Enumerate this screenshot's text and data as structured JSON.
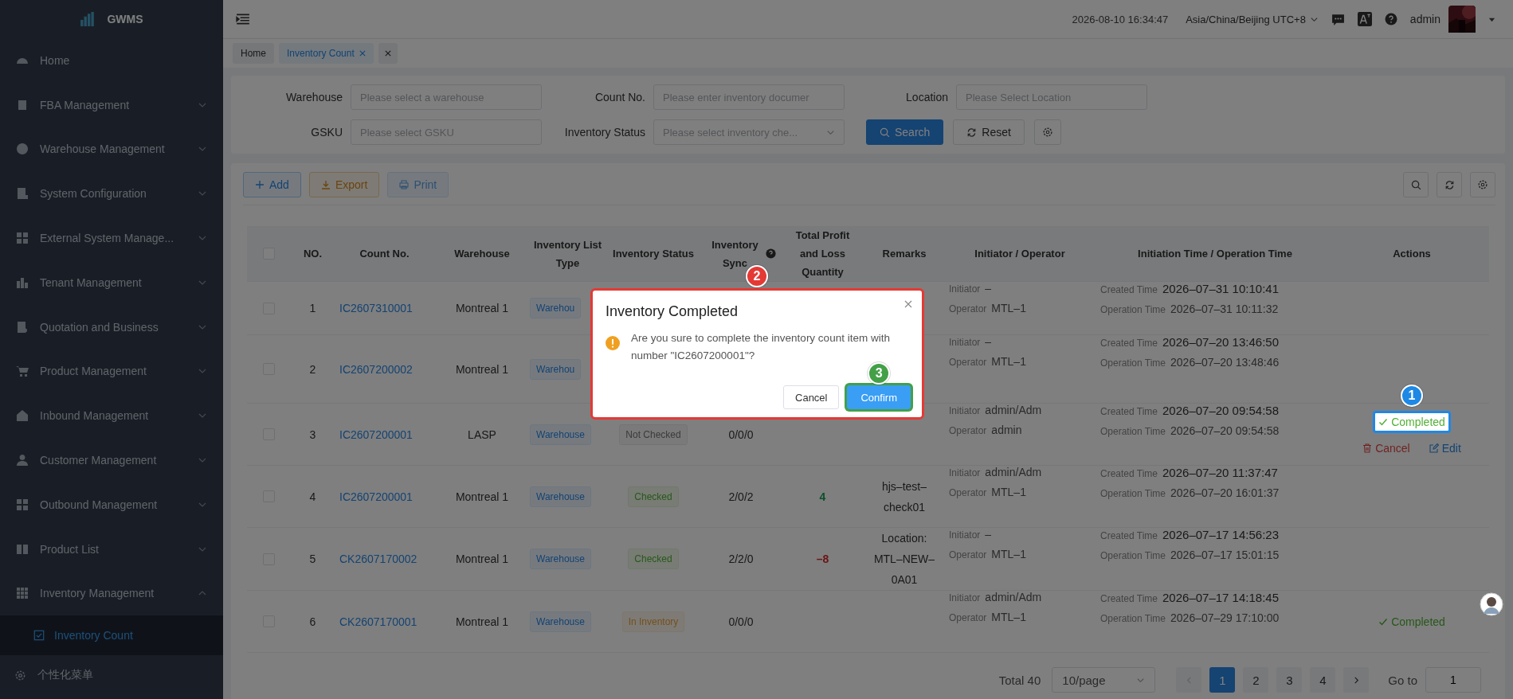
{
  "brand": "GWMS",
  "sidebar": {
    "items": [
      {
        "label": "Home"
      },
      {
        "label": "FBA Management",
        "expanded": false
      },
      {
        "label": "Warehouse Management",
        "expanded": false
      },
      {
        "label": "System Configuration",
        "expanded": false
      },
      {
        "label": "External System Manage...",
        "expanded": false
      },
      {
        "label": "Tenant Management",
        "expanded": false
      },
      {
        "label": "Quotation and Business",
        "expanded": false
      },
      {
        "label": "Product Management",
        "expanded": false
      },
      {
        "label": "Inbound Management",
        "expanded": false
      },
      {
        "label": "Customer Management",
        "expanded": false
      },
      {
        "label": "Outbound Management",
        "expanded": false
      },
      {
        "label": "Product List",
        "expanded": false
      },
      {
        "label": "Inventory Management",
        "expanded": true,
        "children": [
          {
            "label": "Inventory Count",
            "selected": true
          }
        ]
      }
    ],
    "footer": "个性化菜单"
  },
  "header": {
    "datetime": "2026-08-10 16:34:47",
    "timezone": "Asia/China/Beijing UTC+8",
    "user": "admin"
  },
  "tabs": [
    {
      "label": "Home",
      "selected": false,
      "closable": false
    },
    {
      "label": "Inventory Count",
      "selected": true,
      "closable": true
    }
  ],
  "close_all_tabs": true,
  "filters": [
    {
      "label": "Warehouse",
      "placeholder": "Please select a warehouse",
      "kind": "input"
    },
    {
      "label": "Count No.",
      "placeholder": "Please enter inventory documer",
      "kind": "input"
    },
    {
      "label": "Location",
      "placeholder": "Please Select Location",
      "kind": "input"
    },
    {
      "label": "GSKU",
      "placeholder": "Please select GSKU",
      "kind": "input"
    },
    {
      "label": "Inventory Status",
      "placeholder": "Please select inventory che...",
      "kind": "select"
    }
  ],
  "filter_buttons": [
    {
      "label": "Search",
      "kind": "search"
    },
    {
      "label": "Reset",
      "kind": "reset"
    }
  ],
  "toolbar": [
    {
      "label": "Add",
      "kind": "add",
      "disabled": false
    },
    {
      "label": "Export",
      "kind": "export",
      "disabled": false
    },
    {
      "label": "Print",
      "kind": "print",
      "disabled": true
    }
  ],
  "table": {
    "all_checked": false,
    "columns": [
      "NO.",
      "Count No.",
      "Warehouse",
      "Inventory List Type",
      "Inventory Status",
      "Inventory Sync",
      "Total Profit and Loss Quantity",
      "Remarks",
      "Initiator / Operator",
      "Initiation Time / Operation Time",
      "Actions"
    ],
    "rows": [
      {
        "checked": false,
        "no": "1",
        "count_no": "IC2607310001",
        "warehouse": "Montreal 1",
        "list_type": "Warehou",
        "initiator_label": "Initiator",
        "initiator": "–",
        "operator_label": "Operator",
        "operator": "MTL–1",
        "created_label": "Created Time",
        "created": "2026–07–31 10:10:41",
        "operation_label": "Operation Time",
        "operation": "2026–07–31 10:11:32",
        "actions": []
      },
      {
        "checked": false,
        "no": "2",
        "count_no": "IC2607200002",
        "warehouse": "Montreal 1",
        "list_type": "Warehou",
        "initiator_label": "Initiator",
        "initiator": "–",
        "operator_label": "Operator",
        "operator": "MTL–1",
        "created_label": "Created Time",
        "created": "2026–07–20 13:46:50",
        "operation_label": "Operation Time",
        "operation": "2026–07–20 13:48:46",
        "actions": []
      },
      {
        "checked": false,
        "no": "3",
        "count_no": "IC2607200001",
        "warehouse": "LASP",
        "list_type": "Warehouse",
        "status": {
          "label": "Not Checked",
          "kind": "not_checked"
        },
        "sync": "0/0/0",
        "initiator_label": "Initiator",
        "initiator": "admin/Adm",
        "operator_label": "Operator",
        "operator": "admin",
        "created_label": "Created Time",
        "created": "2026–07–20 09:54:58",
        "operation_label": "Operation Time",
        "operation": "2026–07–20 09:54:58",
        "actions": [
          {
            "label": "Completed",
            "kind": "complete",
            "callout": {
              "number": "1",
              "color": "#1e88e5"
            }
          },
          {
            "label": "Cancel",
            "kind": "cancel"
          },
          {
            "label": "Edit",
            "kind": "edit"
          }
        ]
      },
      {
        "checked": false,
        "no": "4",
        "count_no": "IC2607200001",
        "warehouse": "Montreal 1",
        "list_type": "Warehouse",
        "status": {
          "label": "Checked",
          "kind": "checked"
        },
        "sync": "2/0/2",
        "total": {
          "value": "4",
          "kind": "gain"
        },
        "remarks": "hjs–test–check01",
        "initiator_label": "Initiator",
        "initiator": "admin/Adm",
        "operator_label": "Operator",
        "operator": "MTL–1",
        "created_label": "Created Time",
        "created": "2026–07–20 11:37:47",
        "operation_label": "Operation Time",
        "operation": "2026–07–20 16:01:37",
        "actions": []
      },
      {
        "checked": false,
        "no": "5",
        "count_no": "CK2607170002",
        "warehouse": "Montreal 1",
        "list_type": "Warehouse",
        "status": {
          "label": "Checked",
          "kind": "checked"
        },
        "sync": "2/2/0",
        "total": {
          "value": "–8",
          "kind": "loss"
        },
        "remarks": "Location: MTL–NEW–0A01",
        "initiator_label": "Initiator",
        "initiator": "–",
        "operator_label": "Operator",
        "operator": "MTL–1",
        "created_label": "Created Time",
        "created": "2026–07–17 14:56:23",
        "operation_label": "Operation Time",
        "operation": "2026–07–17 15:01:15",
        "actions": []
      },
      {
        "checked": false,
        "no": "6",
        "count_no": "CK2607170001",
        "warehouse": "Montreal 1",
        "list_type": "Warehouse",
        "status": {
          "label": "In Inventory",
          "kind": "in_inventory"
        },
        "sync": "0/0/0",
        "initiator_label": "Initiator",
        "initiator": "admin/Adm",
        "operator_label": "Operator",
        "operator": "MTL–1",
        "created_label": "Created Time",
        "created": "2026–07–17 14:18:45",
        "operation_label": "Operation Time",
        "operation": "2026–07–29 17:10:00",
        "actions": [
          {
            "label": "Completed",
            "kind": "complete"
          }
        ]
      }
    ]
  },
  "pagination": {
    "total": "Total 40",
    "page_size": "10/page",
    "pages": [
      {
        "label": "1",
        "selected": true
      },
      {
        "label": "2",
        "selected": false
      },
      {
        "label": "3",
        "selected": false
      },
      {
        "label": "4",
        "selected": false
      }
    ],
    "prev_disabled": true,
    "goto_label": "Go to",
    "goto_value": "1"
  },
  "dialog": {
    "title": "Inventory Completed",
    "message": "Are you sure to complete the inventory count item with number \"IC2607200001\"?",
    "cancel": "Cancel",
    "confirm": "Confirm",
    "callout": {
      "number": "2",
      "color": "#e53935"
    },
    "confirm_callout": {
      "number": "3",
      "color": "#43a047"
    }
  }
}
